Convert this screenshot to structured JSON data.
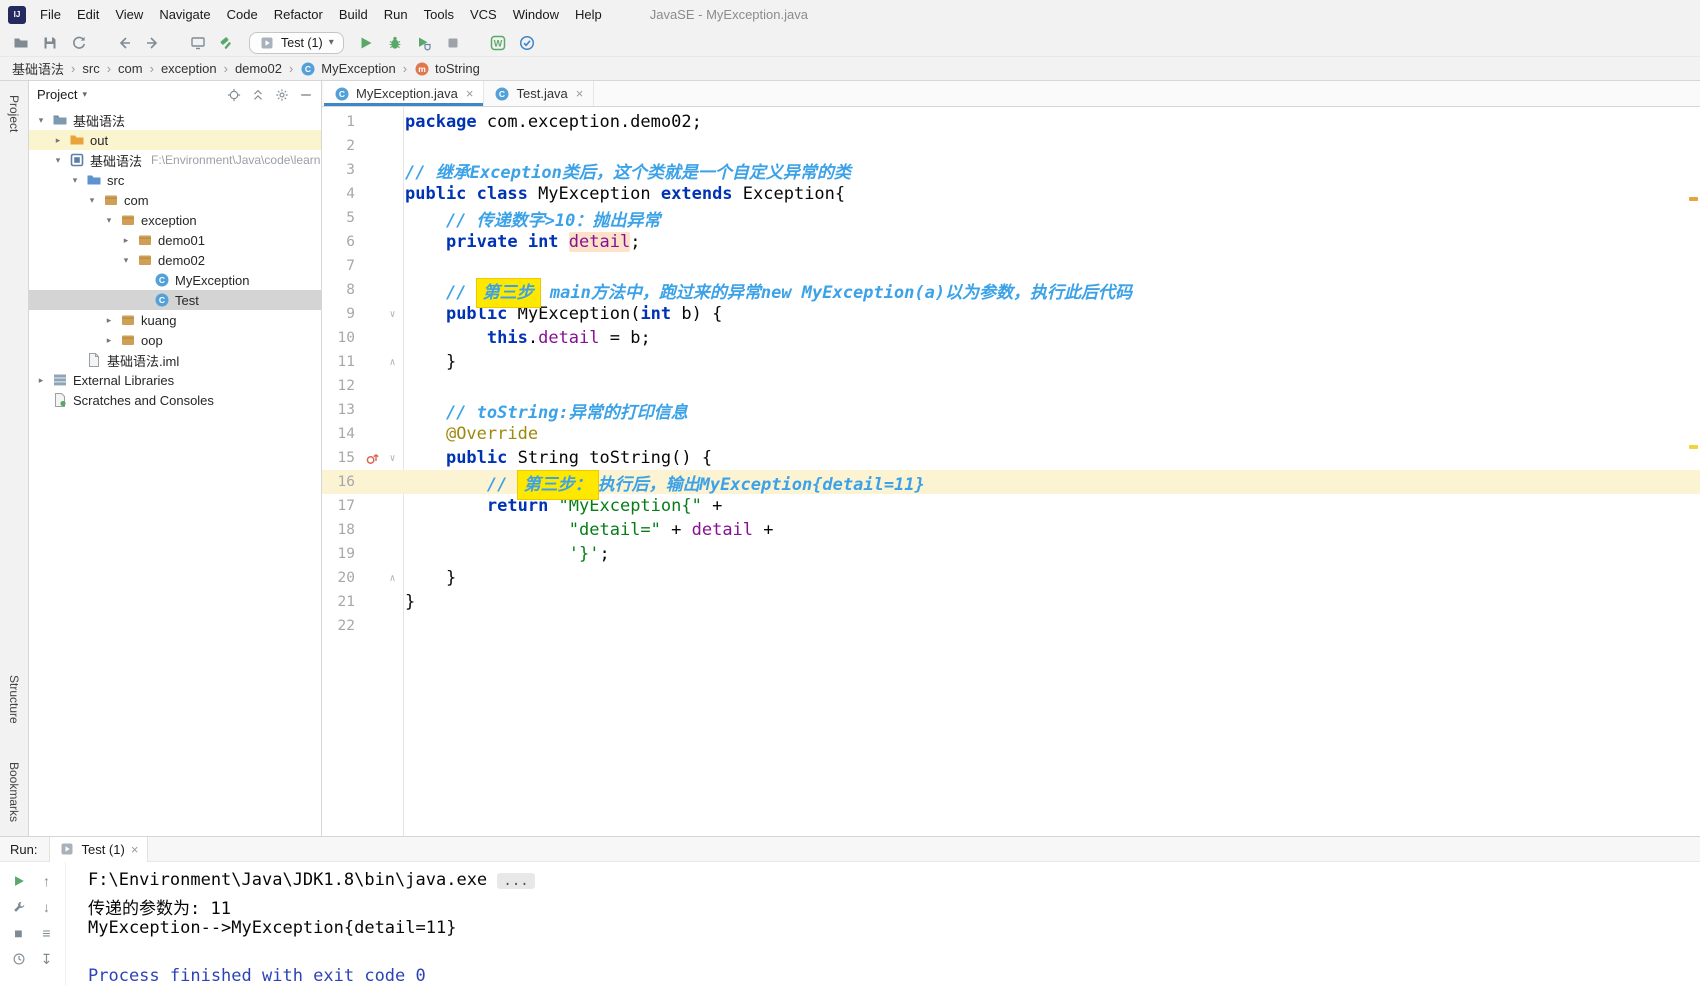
{
  "window": {
    "title": "JavaSE - MyException.java",
    "logo": "IJ"
  },
  "menu": [
    "File",
    "Edit",
    "View",
    "Navigate",
    "Code",
    "Refactor",
    "Build",
    "Run",
    "Tools",
    "VCS",
    "Window",
    "Help"
  ],
  "toolbar": {
    "run_config": "Test (1)"
  },
  "breadcrumbs": [
    {
      "label": "基础语法"
    },
    {
      "label": "src"
    },
    {
      "label": "com"
    },
    {
      "label": "exception"
    },
    {
      "label": "demo02"
    },
    {
      "label": "MyException",
      "icon": "class"
    },
    {
      "label": "toString",
      "icon": "method"
    }
  ],
  "stripes": {
    "top": "Project",
    "bottom": [
      "Structure",
      "Bookmarks"
    ]
  },
  "project_panel": {
    "title": "Project",
    "tree": [
      {
        "label": "基础语法",
        "level": 0,
        "arrow": "down",
        "icon": "folder"
      },
      {
        "label": "out",
        "level": 1,
        "arrow": "right",
        "icon": "folder-excluded",
        "excluded": true
      },
      {
        "label": "基础语法",
        "suffix": "F:\\Environment\\Java\\code\\learni",
        "level": 1,
        "arrow": "down",
        "icon": "module"
      },
      {
        "label": "src",
        "level": 2,
        "arrow": "down",
        "icon": "folder-src"
      },
      {
        "label": "com",
        "level": 3,
        "arrow": "down",
        "icon": "package"
      },
      {
        "label": "exception",
        "level": 4,
        "arrow": "down",
        "icon": "package"
      },
      {
        "label": "demo01",
        "level": 5,
        "arrow": "right",
        "icon": "package"
      },
      {
        "label": "demo02",
        "level": 5,
        "arrow": "down",
        "icon": "package"
      },
      {
        "label": "MyException",
        "level": 6,
        "icon": "class"
      },
      {
        "label": "Test",
        "level": 6,
        "icon": "class",
        "selected": true
      },
      {
        "label": "kuang",
        "level": 4,
        "arrow": "right",
        "icon": "package"
      },
      {
        "label": "oop",
        "level": 4,
        "arrow": "right",
        "icon": "package"
      },
      {
        "label": "基础语法.iml",
        "level": 2,
        "icon": "file"
      },
      {
        "label": "External Libraries",
        "level": 0,
        "arrow": "right",
        "icon": "library"
      },
      {
        "label": "Scratches and Consoles",
        "level": 0,
        "icon": "scratch"
      }
    ]
  },
  "editor": {
    "tabs": [
      {
        "label": "MyException.java",
        "icon": "class",
        "active": true
      },
      {
        "label": "Test.java",
        "icon": "class",
        "active": false
      }
    ],
    "lines": [
      {
        "n": 1,
        "tokens": [
          [
            "kw",
            "package "
          ],
          [
            "pln",
            "com.exception.demo02;"
          ]
        ]
      },
      {
        "n": 2,
        "tokens": []
      },
      {
        "n": 3,
        "tokens": [
          [
            "cmt",
            "// 继承Exception类后，这个类就是一个自定义异常的类"
          ]
        ]
      },
      {
        "n": 4,
        "tokens": [
          [
            "kw",
            "public class "
          ],
          [
            "pln",
            "MyException "
          ],
          [
            "kw",
            "extends "
          ],
          [
            "pln",
            "Exception{"
          ]
        ]
      },
      {
        "n": 5,
        "tokens": [
          [
            "cmt",
            "    // 传递数字>10：抛出异常"
          ]
        ]
      },
      {
        "n": 6,
        "tokens": [
          [
            "pln",
            "    "
          ],
          [
            "kw",
            "private int "
          ],
          [
            "fld hl-field",
            "detail"
          ],
          [
            "pln",
            ";"
          ]
        ]
      },
      {
        "n": 7,
        "tokens": []
      },
      {
        "n": 8,
        "tokens": [
          [
            "cmt",
            "    // "
          ],
          [
            "cmt hl-box",
            "第三步"
          ],
          [
            "cmt",
            " main方法中，跑过来的异常new MyException(a)以为参数，执行此后代码"
          ]
        ]
      },
      {
        "n": 9,
        "fold": "down",
        "tokens": [
          [
            "pln",
            "    "
          ],
          [
            "kw",
            "public "
          ],
          [
            "pln",
            "MyException("
          ],
          [
            "kw",
            "int "
          ],
          [
            "pln",
            "b) {"
          ]
        ]
      },
      {
        "n": 10,
        "tokens": [
          [
            "pln",
            "        "
          ],
          [
            "kw",
            "this"
          ],
          [
            "pln",
            "."
          ],
          [
            "fld",
            "detail"
          ],
          [
            "pln",
            " = b;"
          ]
        ]
      },
      {
        "n": 11,
        "fold": "up",
        "tokens": [
          [
            "pln",
            "    }"
          ]
        ]
      },
      {
        "n": 12,
        "tokens": []
      },
      {
        "n": 13,
        "tokens": [
          [
            "cmt",
            "    // toString:异常的打印信息"
          ]
        ]
      },
      {
        "n": 14,
        "tokens": [
          [
            "pln",
            "    "
          ],
          [
            "ann",
            "@Override"
          ]
        ]
      },
      {
        "n": 15,
        "fold": "down",
        "marker": "override",
        "tokens": [
          [
            "pln",
            "    "
          ],
          [
            "kw",
            "public "
          ],
          [
            "pln",
            "String toString() {"
          ]
        ]
      },
      {
        "n": 16,
        "current": true,
        "tokens": [
          [
            "cmt",
            "        // "
          ],
          [
            "cmt hl-box",
            "第三步："
          ],
          [
            "cmt",
            "执行后，输出MyException{detail=11}"
          ]
        ]
      },
      {
        "n": 17,
        "tokens": [
          [
            "pln",
            "        "
          ],
          [
            "kw",
            "return "
          ],
          [
            "str",
            "\"MyException{\""
          ],
          [
            "pln",
            " +"
          ]
        ]
      },
      {
        "n": 18,
        "tokens": [
          [
            "pln",
            "                "
          ],
          [
            "str",
            "\"detail=\""
          ],
          [
            "pln",
            " + "
          ],
          [
            "fld",
            "detail"
          ],
          [
            "pln",
            " +"
          ]
        ]
      },
      {
        "n": 19,
        "tokens": [
          [
            "pln",
            "                "
          ],
          [
            "str",
            "'}'"
          ],
          [
            "pln",
            ";"
          ]
        ]
      },
      {
        "n": 20,
        "fold": "up",
        "tokens": [
          [
            "pln",
            "    }"
          ]
        ]
      },
      {
        "n": 21,
        "tokens": [
          [
            "pln",
            "}"
          ]
        ]
      },
      {
        "n": 22,
        "tokens": []
      }
    ]
  },
  "run_panel": {
    "label": "Run:",
    "tab": {
      "label": "Test (1)"
    },
    "output": [
      [
        [
          "opln",
          "F:\\Environment\\Java\\JDK1.8\\bin\\java.exe "
        ],
        [
          "odots",
          "..."
        ]
      ],
      [
        [
          "opln",
          "传递的参数为: 11"
        ]
      ],
      [
        [
          "opln",
          "MyException-->MyException{detail=11}"
        ]
      ],
      [],
      [
        [
          "osys",
          "Process finished with exit code 0"
        ]
      ]
    ]
  },
  "colors": {
    "keyword": "#0033b3",
    "comment": "#3ca2e8",
    "string": "#067d17",
    "field": "#871094",
    "annotation": "#9e880d",
    "current_line": "#fcf3d3",
    "search_highlight": "#ffe800",
    "tree_selection": "#d4d4d4",
    "process_text": "#2c43b8"
  }
}
